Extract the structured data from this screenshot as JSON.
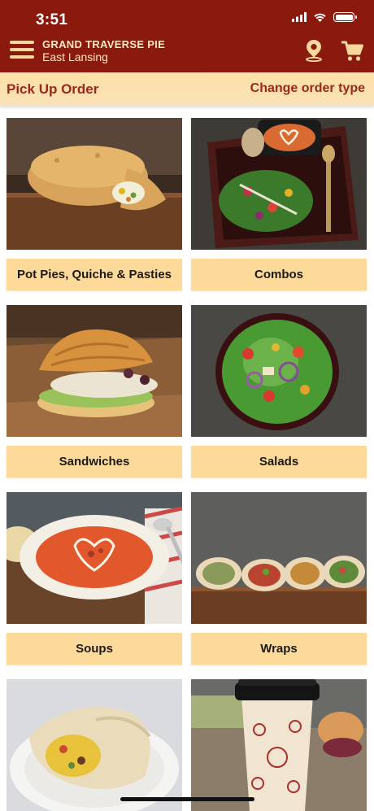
{
  "status_bar": {
    "time": "3:51"
  },
  "header": {
    "store_name": "GRAND TRAVERSE PIE",
    "store_city": "East Lansing",
    "icons": [
      "menu-icon",
      "location-pin-icon",
      "cart-icon"
    ]
  },
  "order_bar": {
    "order_type": "Pick Up Order",
    "change_label": "Change order type"
  },
  "categories": [
    {
      "label": "Pot Pies, Quiche & Pasties",
      "photo": "pot-pie-photo"
    },
    {
      "label": "Combos",
      "photo": "combo-photo"
    },
    {
      "label": "Sandwiches",
      "photo": "croissant-sandwich-photo"
    },
    {
      "label": "Salads",
      "photo": "salad-photo"
    },
    {
      "label": "Soups",
      "photo": "soup-photo"
    },
    {
      "label": "Wraps",
      "photo": "wraps-photo"
    },
    {
      "label": "",
      "photo": "breakfast-burrito-photo"
    },
    {
      "label": "",
      "photo": "coffee-cup-photo"
    }
  ],
  "colors": {
    "header": "#8b1a0e",
    "order_bar": "#fde0a7",
    "accent_text": "#9b2818",
    "tile_label_bg": "#fdd99a"
  }
}
